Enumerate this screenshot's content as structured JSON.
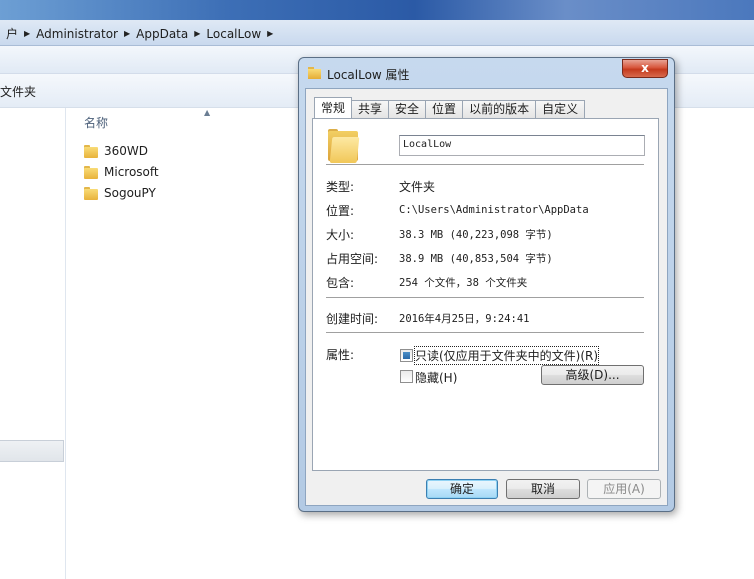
{
  "explorer": {
    "breadcrumb": [
      "户",
      "Administrator",
      "AppData",
      "LocalLow"
    ],
    "toolbar_item": "文件夹",
    "column_name": "名称",
    "files": [
      "360WD",
      "Microsoft",
      "SogouPY"
    ]
  },
  "dialog": {
    "title": "LocalLow 属性",
    "close_label": "x",
    "tabs": [
      "常规",
      "共享",
      "安全",
      "位置",
      "以前的版本",
      "自定义"
    ],
    "active_tab": "常规",
    "folder_name": "LocalLow",
    "properties": {
      "type_label": "类型:",
      "type_value": "文件夹",
      "location_label": "位置:",
      "location_value": "C:\\Users\\Administrator\\AppData",
      "size_label": "大小:",
      "size_value": "38.3 MB (40,223,098 字节)",
      "disk_size_label": "占用空间:",
      "disk_size_value": "38.9 MB (40,853,504 字节)",
      "contains_label": "包含:",
      "contains_value": "254 个文件，38 个文件夹",
      "created_label": "创建时间:",
      "created_value": "2016年4月25日，9:24:41",
      "attributes_label": "属性:"
    },
    "attributes": {
      "readonly_label": "只读(仅应用于文件夹中的文件)(R)",
      "readonly_state": "indeterminate",
      "hidden_label": "隐藏(H)",
      "hidden_checked": false,
      "advanced_label": "高级(D)..."
    },
    "buttons": {
      "ok": "确定",
      "cancel": "取消",
      "apply": "应用(A)"
    }
  },
  "colors": {
    "dialog_frame": "#b3cae4",
    "close_button": "#c43a1e",
    "default_button": "#3c7fb1",
    "folder_yellow": "#f1c758"
  }
}
